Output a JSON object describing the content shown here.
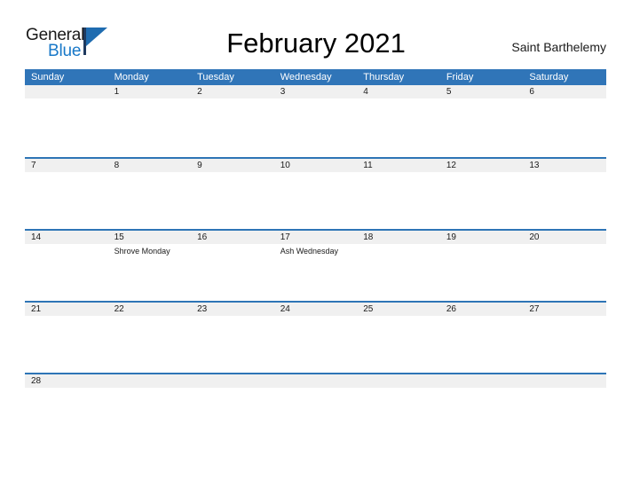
{
  "brand": {
    "name_part1": "General",
    "name_part2": "Blue",
    "flag_icon": "blue-flag-triangle-icon"
  },
  "header": {
    "title": "February 2021",
    "location": "Saint Barthelemy"
  },
  "theme": {
    "header_blue": "#3075b8",
    "row_divider_blue": "#2e75b6",
    "day_band_gray": "#f0f0f0",
    "logo_blue": "#1878c8",
    "page_background": "#ffffff"
  },
  "calendar": {
    "weekdays": [
      "Sunday",
      "Monday",
      "Tuesday",
      "Wednesday",
      "Thursday",
      "Friday",
      "Saturday"
    ],
    "weeks": [
      {
        "days": [
          {
            "num": "",
            "event": ""
          },
          {
            "num": "1",
            "event": ""
          },
          {
            "num": "2",
            "event": ""
          },
          {
            "num": "3",
            "event": ""
          },
          {
            "num": "4",
            "event": ""
          },
          {
            "num": "5",
            "event": ""
          },
          {
            "num": "6",
            "event": ""
          }
        ]
      },
      {
        "days": [
          {
            "num": "7",
            "event": ""
          },
          {
            "num": "8",
            "event": ""
          },
          {
            "num": "9",
            "event": ""
          },
          {
            "num": "10",
            "event": ""
          },
          {
            "num": "11",
            "event": ""
          },
          {
            "num": "12",
            "event": ""
          },
          {
            "num": "13",
            "event": ""
          }
        ]
      },
      {
        "days": [
          {
            "num": "14",
            "event": ""
          },
          {
            "num": "15",
            "event": "Shrove Monday"
          },
          {
            "num": "16",
            "event": ""
          },
          {
            "num": "17",
            "event": "Ash Wednesday"
          },
          {
            "num": "18",
            "event": ""
          },
          {
            "num": "19",
            "event": ""
          },
          {
            "num": "20",
            "event": ""
          }
        ]
      },
      {
        "days": [
          {
            "num": "21",
            "event": ""
          },
          {
            "num": "22",
            "event": ""
          },
          {
            "num": "23",
            "event": ""
          },
          {
            "num": "24",
            "event": ""
          },
          {
            "num": "25",
            "event": ""
          },
          {
            "num": "26",
            "event": ""
          },
          {
            "num": "27",
            "event": ""
          }
        ]
      },
      {
        "days": [
          {
            "num": "28",
            "event": ""
          },
          {
            "num": "",
            "event": ""
          },
          {
            "num": "",
            "event": ""
          },
          {
            "num": "",
            "event": ""
          },
          {
            "num": "",
            "event": ""
          },
          {
            "num": "",
            "event": ""
          },
          {
            "num": "",
            "event": ""
          }
        ]
      }
    ]
  }
}
